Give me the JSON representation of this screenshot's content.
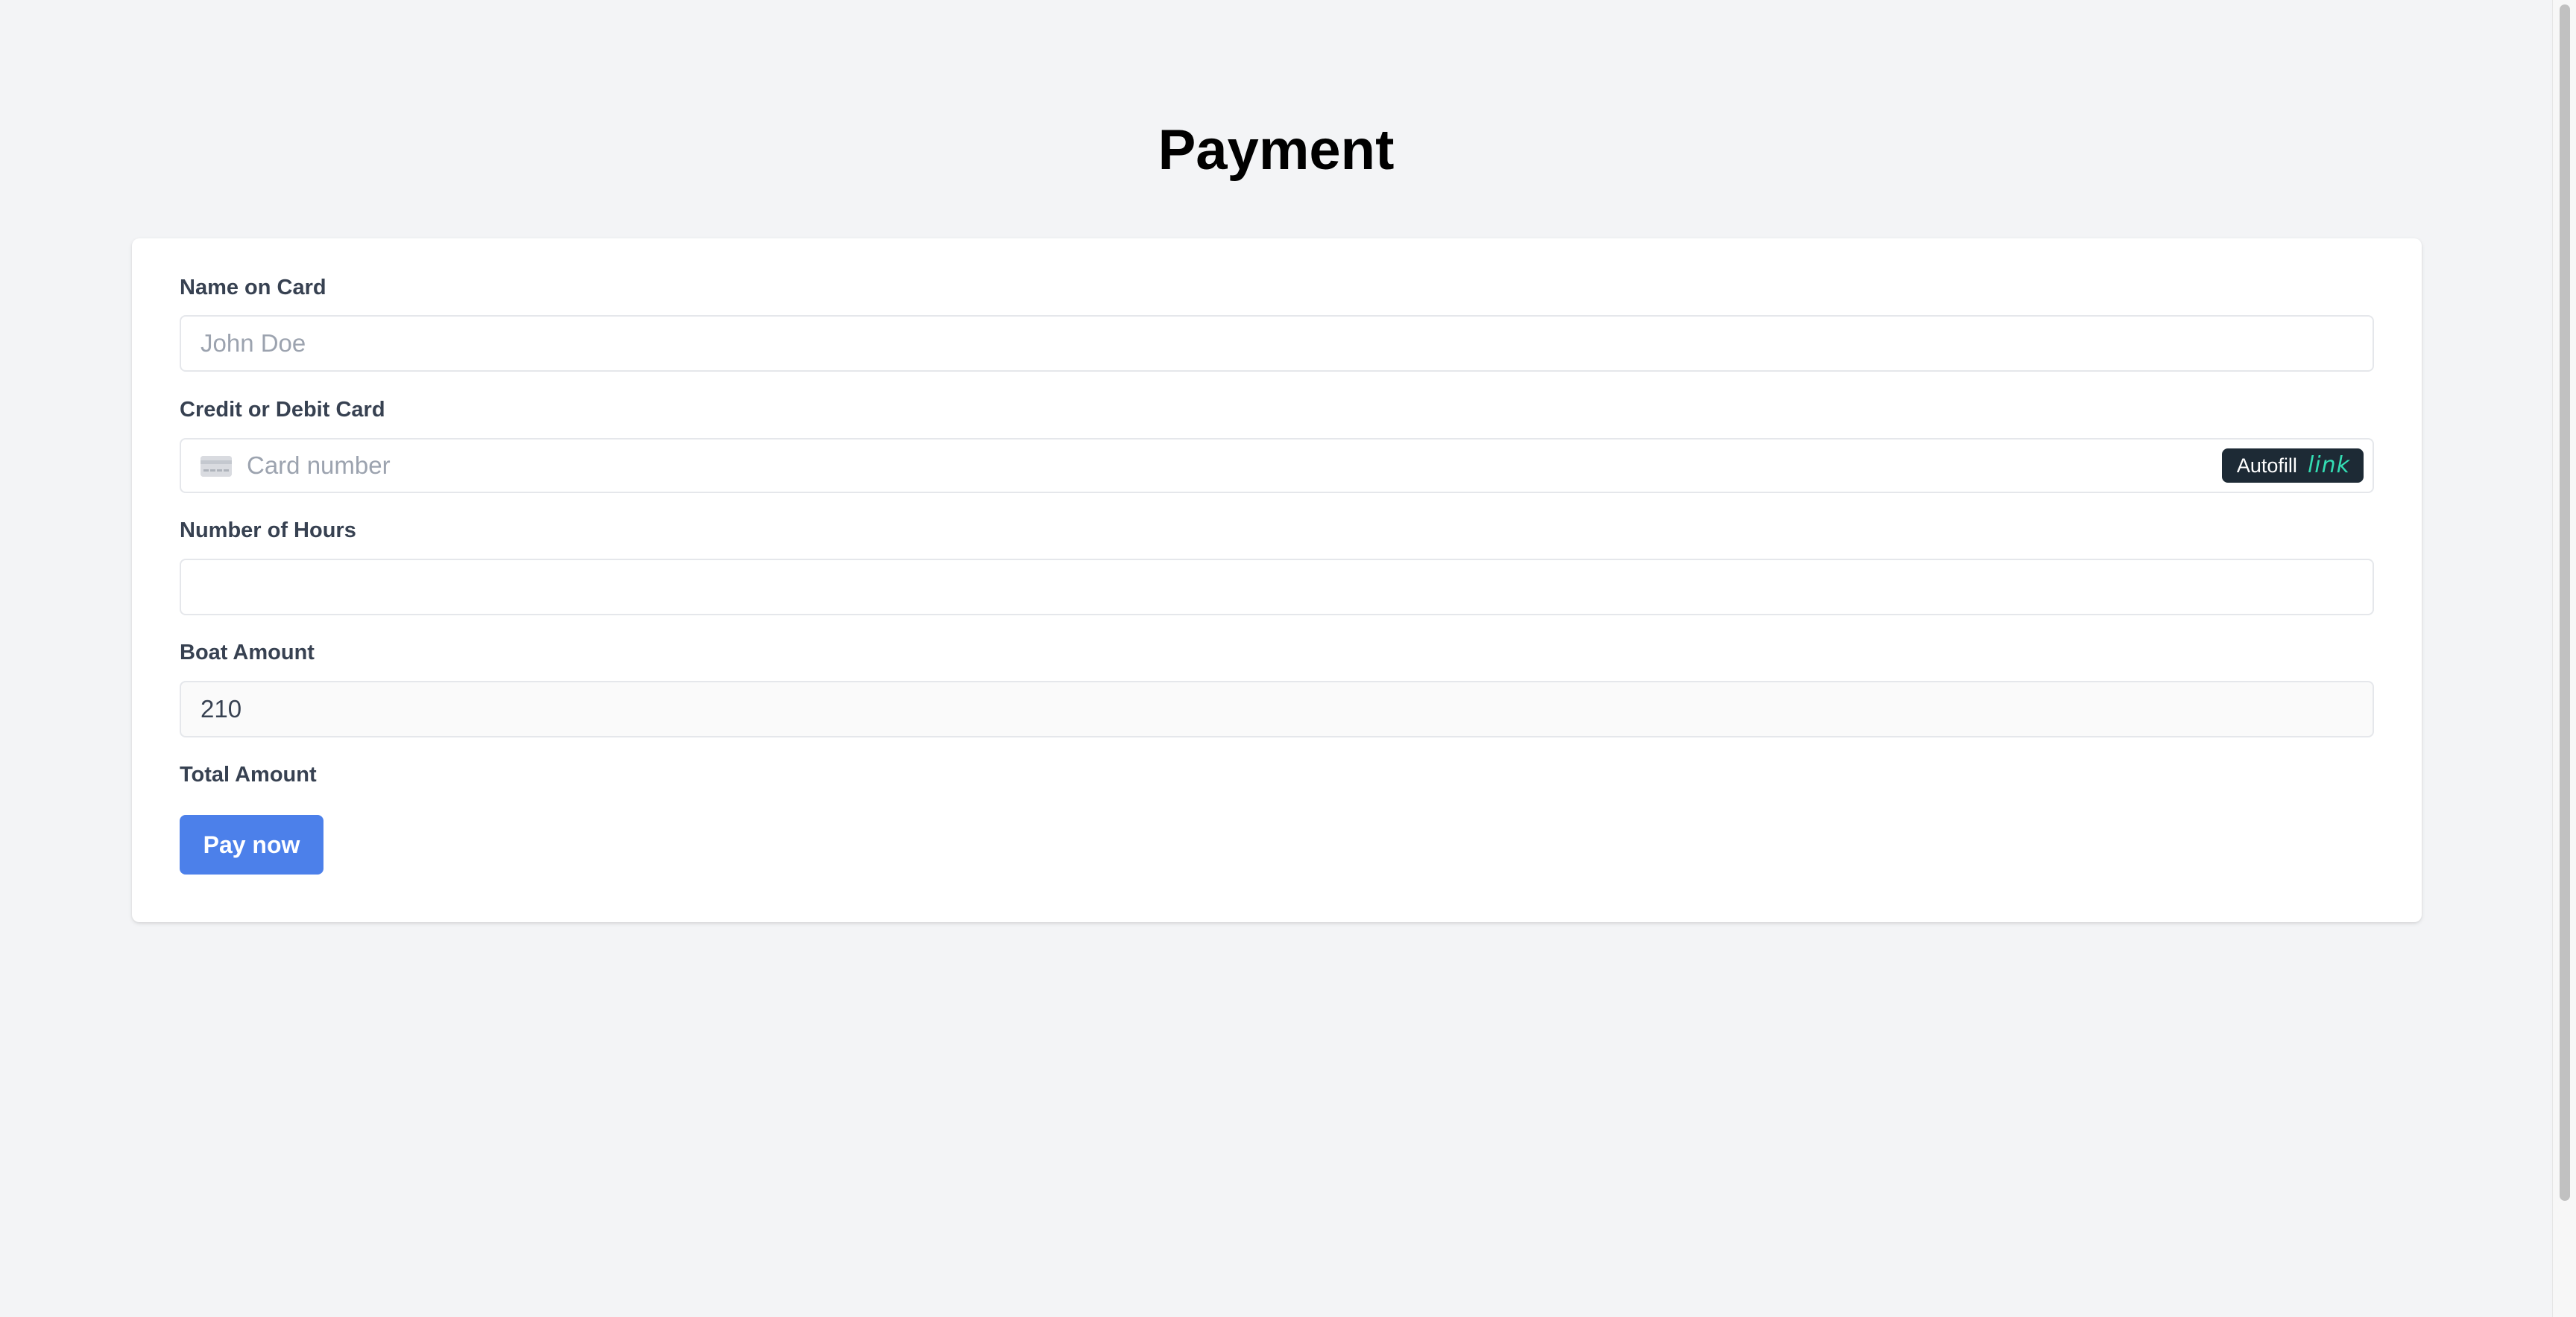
{
  "page": {
    "title": "Payment"
  },
  "form": {
    "name_on_card": {
      "label": "Name on Card",
      "value": "",
      "placeholder": "John Doe"
    },
    "card": {
      "label": "Credit or Debit Card",
      "value": "",
      "placeholder": "Card number",
      "icon": "credit-card-icon",
      "autofill_label": "Autofill",
      "autofill_brand": "link"
    },
    "hours": {
      "label": "Number of Hours",
      "value": "",
      "placeholder": ""
    },
    "boat_amount": {
      "label": "Boat Amount",
      "value": "210"
    },
    "total_amount": {
      "label": "Total Amount"
    },
    "submit_label": "Pay now"
  },
  "colors": {
    "background": "#f3f4f6",
    "card": "#ffffff",
    "primary_button": "#4c80ea",
    "autofill_bg": "#1d2a35",
    "link_brand": "#33ddb3"
  }
}
